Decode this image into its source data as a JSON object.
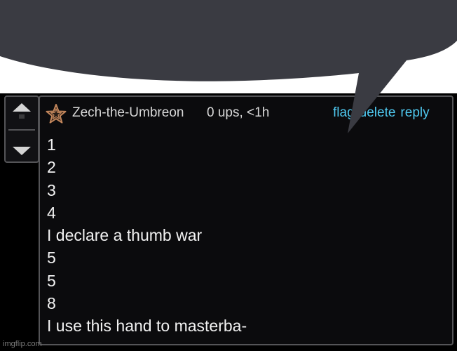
{
  "vote": {
    "up_icon": "triangle-up",
    "down_icon": "triangle-down"
  },
  "comment": {
    "badge_icon": "star-badge",
    "username": "Zech-the-Umbreon",
    "meta": "0 ups, <1h",
    "actions": {
      "flag": "flag",
      "delete": "delete",
      "reply": "reply"
    },
    "lines": [
      "1",
      "2",
      "3",
      "4",
      "I declare a thumb war",
      "5",
      "5",
      "8",
      "I use this hand to masterba-"
    ]
  },
  "overlay": {
    "shape": "speech-bubble",
    "color": "#3a3b42"
  },
  "watermark": "imgflip.com",
  "colors": {
    "background": "#000000",
    "panel": "#0b0b0d",
    "border": "#545457",
    "text": "#f2f2f2",
    "link": "#4fc9f0",
    "badge": "#c4875c"
  }
}
